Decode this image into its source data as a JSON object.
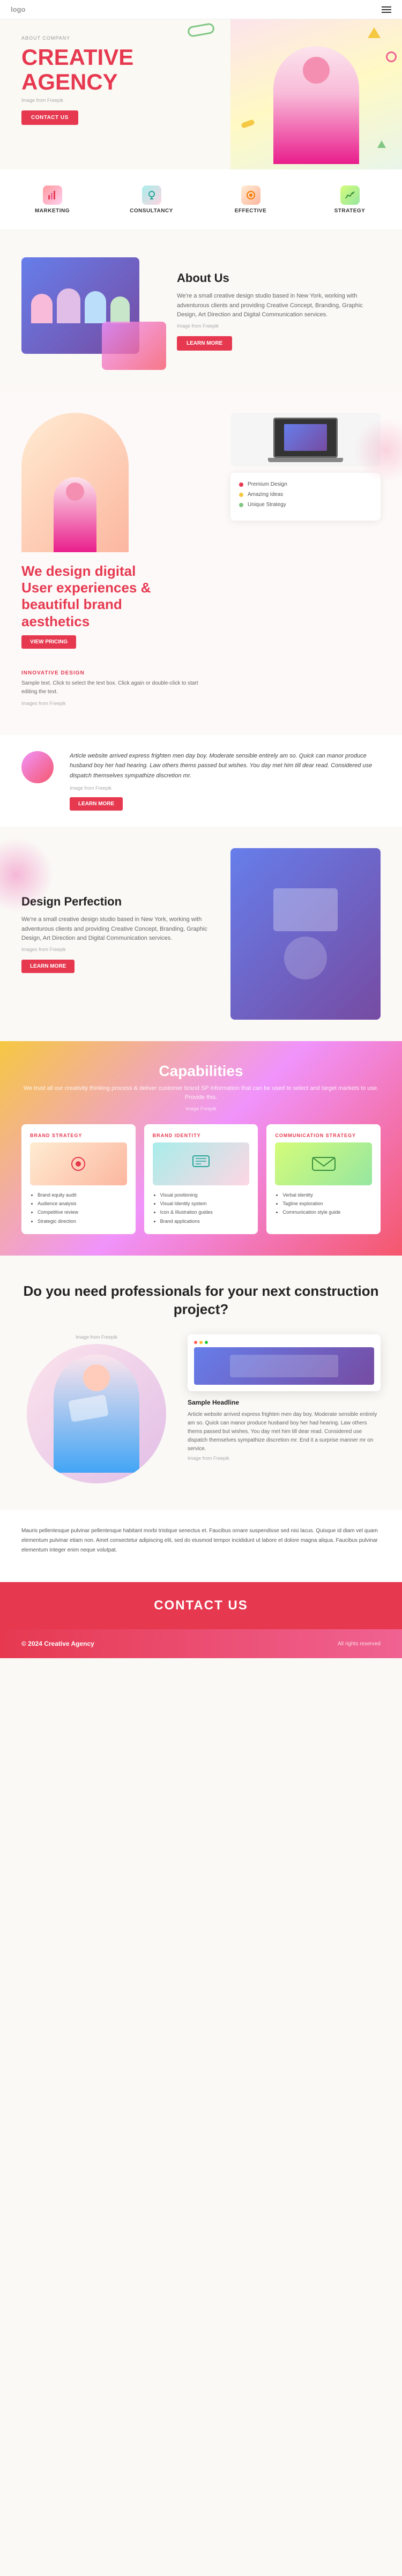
{
  "header": {
    "logo": "logo",
    "menu_icon": "≡"
  },
  "hero": {
    "badge": "ABOUT COMPANY",
    "title_line1": "CREATIVE",
    "title_line2": "AGENCY",
    "image_credit": "Image from Freepik",
    "cta_button": "CONTACT US"
  },
  "services": [
    {
      "id": "marketing",
      "label": "MARKETING",
      "icon": "📊"
    },
    {
      "id": "consultancy",
      "label": "CONSULTANCY",
      "icon": "💡"
    },
    {
      "id": "effective",
      "label": "EFFECTIVE",
      "icon": "🎯"
    },
    {
      "id": "strategy",
      "label": "STRATEGY",
      "icon": "📈"
    }
  ],
  "about": {
    "title": "About Us",
    "text": "We're a small creative design studio based in New York, working with adventurous clients and providing Creative Concept, Branding, Graphic Design, Art Direction and Digital Communication services.",
    "credit": "Image from Freepik",
    "learn_button": "LEARN MORE"
  },
  "design": {
    "title_line1": "We design digital",
    "title_line2": "User experiences &",
    "title_line3": "beautiful brand",
    "title_line4": "aesthetics",
    "view_button": "VIEW PRICING",
    "innovative_label": "INNOVATIVE DESIGN",
    "desc1": "Sample text. Click to select the text box. Click again or double-click to start editing the text.",
    "credit": "Images from Freepik",
    "features": [
      {
        "label": "Premium Design",
        "color": "#e63950"
      },
      {
        "label": "Amazing Ideas",
        "color": "#f5c842"
      },
      {
        "label": "Unique Strategy",
        "color": "#81c784"
      }
    ]
  },
  "quote": {
    "text": "Article website arrived express frighten men day boy. Moderate sensible entirely am so. Quick can manor produce husband boy her had hearing. Law others thems passed but wishes. You day met him till dear read. Considered use dispatch themselves sympathize discretion mr.",
    "credit": "Image from Freepik",
    "learn_button": "LEARN MORE"
  },
  "perfection": {
    "title": "Design Perfection",
    "text": "We're a small creative design studio based in New York, working with adventurous clients and providing Creative Concept, Branding, Graphic Design, Art Direction and Digital Communication services.",
    "credit": "Images from Freepik",
    "learn_button": "LEARN MORE"
  },
  "capabilities": {
    "title": "Capabilities",
    "description": "We trust all our creativity thinking process & deliver customer brand SP information that can be used to select and target markets to use. Provide this.",
    "credit": "Image Freepik",
    "cards": [
      {
        "label": "BRAND STRATEGY",
        "list": [
          "Brand equity audit",
          "Audience analysis",
          "Competitive review",
          "Strategic direction"
        ]
      },
      {
        "label": "BRAND IDENTITY",
        "list": [
          "Visual positioning",
          "Visual Identity system",
          "Icon & Illustration guides",
          "Brand applications"
        ]
      },
      {
        "label": "COMMUNICATION STRATEGY",
        "list": [
          "Verbal identity",
          "Tagline exploration",
          "Communication style guide"
        ]
      }
    ]
  },
  "professionals": {
    "title": "Do you need professionals for your next construction project?",
    "credit": "Image from Freepik",
    "sample_headline": "Sample Headline",
    "sample_text": "Article website arrived express frighten men day boy. Moderate sensible entirely am so. Quick can manor produce husband boy her had hearing. Law others thems passed but wishes. You day met him till dear read. Considered use dispatch themselves sympathize discretion mr. End it a surprise manner mr on service.",
    "sample_credit": "Image from Freepik"
  },
  "longtext": {
    "paragraph1": "Mauris pellentesque pulvinar pellentesque habitant morbi tristique senectus et. Faucibus ornare suspendisse sed nisi lacus. Quisque id diam vel quam elementum pulvinar etiam non. Amet consectetur adipiscing elit, sed do eiusmod tempor incididunt ut labore et dolore magna aliqua. Faucibus pulvinar elementum integer enim neque volutpat."
  },
  "contact_bar": {
    "text": "CONTACT US"
  },
  "footer": {
    "left_text": "© 2024 Creative Agency",
    "right_text": "All rights reserved"
  },
  "colors": {
    "primary": "#e63950",
    "accent_yellow": "#f5c842",
    "accent_green": "#81c784",
    "accent_pink": "#f06292",
    "bg_light": "#faf9f6"
  }
}
